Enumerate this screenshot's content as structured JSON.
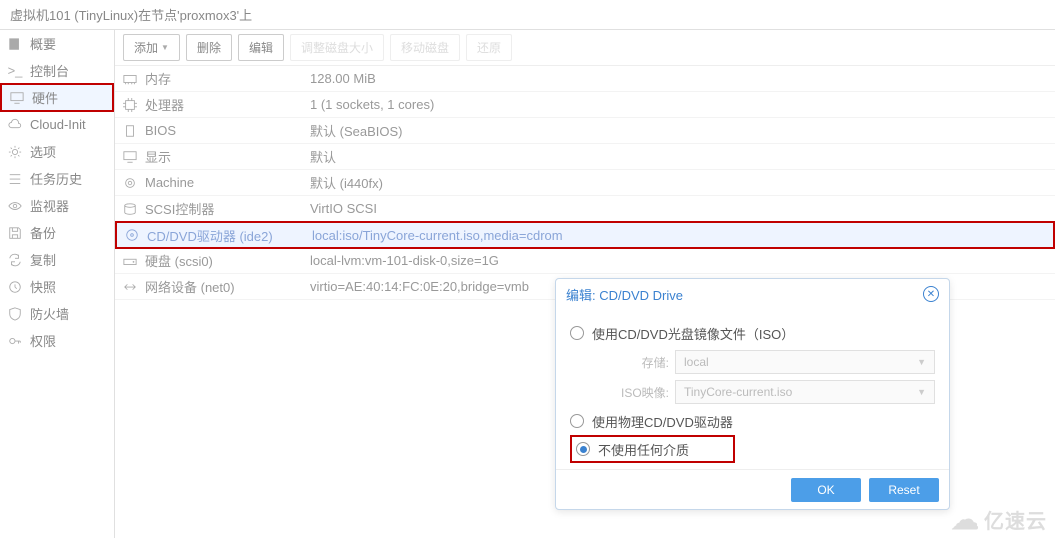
{
  "header": {
    "title": "虚拟机101 (TinyLinux)在节点'proxmox3'上"
  },
  "sidebar": {
    "items": [
      {
        "label": "概要",
        "icon": "book-icon"
      },
      {
        "label": "控制台",
        "icon": "terminal-icon"
      },
      {
        "label": "硬件",
        "icon": "monitor-icon",
        "active": true
      },
      {
        "label": "Cloud-Init",
        "icon": "cloud-icon"
      },
      {
        "label": "选项",
        "icon": "gear-icon"
      },
      {
        "label": "任务历史",
        "icon": "list-icon"
      },
      {
        "label": "监视器",
        "icon": "eye-icon"
      },
      {
        "label": "备份",
        "icon": "save-icon"
      },
      {
        "label": "复制",
        "icon": "sync-icon"
      },
      {
        "label": "快照",
        "icon": "history-icon"
      },
      {
        "label": "防火墙",
        "icon": "shield-icon"
      },
      {
        "label": "权限",
        "icon": "key-icon"
      }
    ]
  },
  "toolbar": {
    "add": "添加",
    "remove": "删除",
    "edit": "编辑",
    "resize": "调整磁盘大小",
    "move": "移动磁盘",
    "revert": "还原"
  },
  "hardware": {
    "rows": [
      {
        "icon": "memory-icon",
        "label": "内存",
        "value": "128.00 MiB"
      },
      {
        "icon": "cpu-icon",
        "label": "处理器",
        "value": "1 (1 sockets, 1 cores)"
      },
      {
        "icon": "bios-icon",
        "label": "BIOS",
        "value": "默认 (SeaBIOS)"
      },
      {
        "icon": "display-icon",
        "label": "显示",
        "value": "默认"
      },
      {
        "icon": "machine-icon",
        "label": "Machine",
        "value": "默认 (i440fx)"
      },
      {
        "icon": "scsi-icon",
        "label": "SCSI控制器",
        "value": "VirtIO SCSI"
      },
      {
        "icon": "disc-icon",
        "label": "CD/DVD驱动器 (ide2)",
        "value": "local:iso/TinyCore-current.iso,media=cdrom",
        "selected": true
      },
      {
        "icon": "hdd-icon",
        "label": "硬盘 (scsi0)",
        "value": "local-lvm:vm-101-disk-0,size=1G"
      },
      {
        "icon": "net-icon",
        "label": "网络设备 (net0)",
        "value": "virtio=AE:40:14:FC:0E:20,bridge=vmb"
      }
    ]
  },
  "dialog": {
    "title": "编辑: CD/DVD Drive",
    "option_iso": "使用CD/DVD光盘镜像文件（ISO）",
    "storage_label": "存储:",
    "storage_value": "local",
    "iso_label": "ISO映像:",
    "iso_value": "TinyCore-current.iso",
    "option_physical": "使用物理CD/DVD驱动器",
    "option_none": "不使用任何介质",
    "ok": "OK",
    "reset": "Reset"
  },
  "watermark": "亿速云"
}
